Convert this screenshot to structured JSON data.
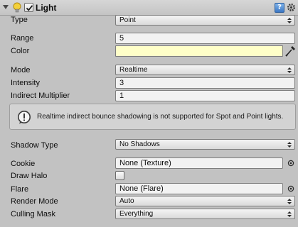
{
  "component": {
    "title": "Light",
    "enabled": true,
    "icons": {
      "foldout": "chevron-down-icon",
      "light": "light-bulb-icon",
      "help": "help-icon",
      "settings": "gear-icon"
    },
    "help_glyph": "?"
  },
  "fields": {
    "type": {
      "label": "Type",
      "value": "Point"
    },
    "range": {
      "label": "Range",
      "value": "5"
    },
    "color": {
      "label": "Color",
      "value": "#ffffc8"
    },
    "mode": {
      "label": "Mode",
      "value": "Realtime"
    },
    "intensity": {
      "label": "Intensity",
      "value": "3"
    },
    "indirect_multiplier": {
      "label": "Indirect Multiplier",
      "value": "1"
    },
    "shadow_type": {
      "label": "Shadow Type",
      "value": "No Shadows"
    },
    "cookie": {
      "label": "Cookie",
      "value": "None (Texture)"
    },
    "draw_halo": {
      "label": "Draw Halo",
      "checked": false
    },
    "flare": {
      "label": "Flare",
      "value": "None (Flare)"
    },
    "render_mode": {
      "label": "Render Mode",
      "value": "Auto"
    },
    "culling_mask": {
      "label": "Culling Mask",
      "value": "Everything"
    }
  },
  "helpbox": {
    "icon": "info-icon",
    "message": "Realtime indirect bounce shadowing is not supported for Spot and Point lights."
  }
}
